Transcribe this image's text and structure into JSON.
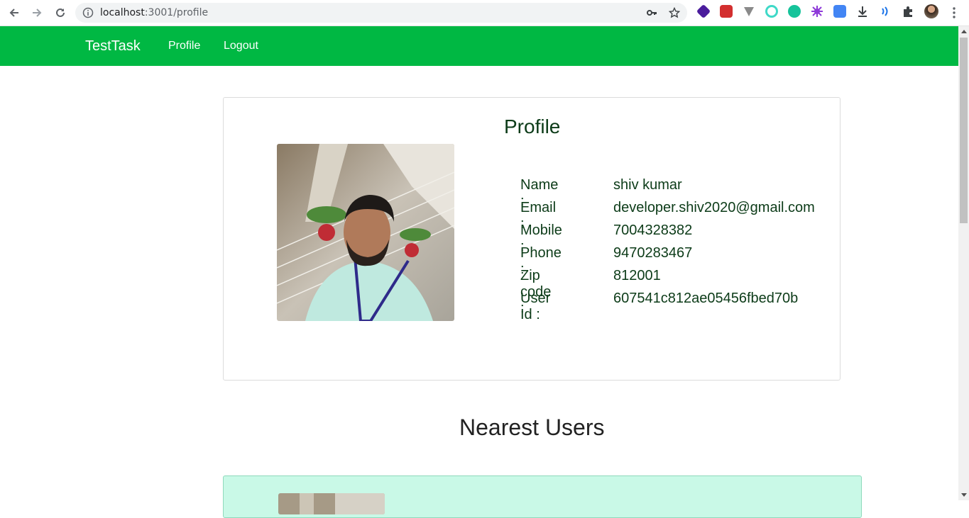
{
  "browser": {
    "url_host": "localhost",
    "url_path": ":3001/profile"
  },
  "navbar": {
    "brand": "TestTask",
    "links": [
      "Profile",
      "Logout"
    ]
  },
  "profile": {
    "title": "Profile",
    "fields": [
      {
        "label": "Name :",
        "value": "shiv kumar"
      },
      {
        "label": "Email :",
        "value": "developer.shiv2020@gmail.com"
      },
      {
        "label": "Mobile :",
        "value": "7004328382"
      },
      {
        "label": "Phone :",
        "value": "9470283467"
      },
      {
        "label": "Zip code :",
        "value": "812001"
      },
      {
        "label": "User Id :",
        "value": "607541c812ae05456fbed70b"
      }
    ]
  },
  "nearest": {
    "title": "Nearest Users"
  },
  "colors": {
    "navbar": "#00b843",
    "text_dark_green": "#0c3b18",
    "nearest_card_bg": "#c9f9e7"
  }
}
